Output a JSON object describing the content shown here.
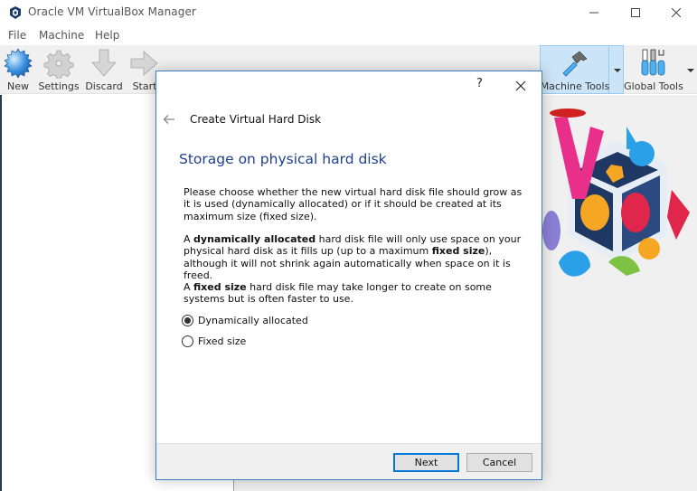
{
  "window": {
    "title": "Oracle VM VirtualBox Manager",
    "app_icon": "virtualbox-logo-icon",
    "controls": {
      "minimize": "minimize-icon",
      "maximize": "maximize-icon",
      "close": "close-icon"
    }
  },
  "menubar": {
    "items": [
      {
        "label": "File"
      },
      {
        "label": "Machine"
      },
      {
        "label": "Help"
      }
    ]
  },
  "toolbar": {
    "buttons": [
      {
        "label": "New",
        "icon": "new-starburst-icon"
      },
      {
        "label": "Settings",
        "icon": "gear-icon"
      },
      {
        "label": "Discard",
        "icon": "down-arrow-icon"
      },
      {
        "label": "Start",
        "icon": "right-arrow-icon"
      }
    ],
    "tools": [
      {
        "label": "Machine Tools",
        "icon": "hammer-icon",
        "active": true
      },
      {
        "label": "Global Tools",
        "icon": "tools-icon",
        "active": false
      }
    ]
  },
  "dialog": {
    "help_label": "?",
    "title": "Create Virtual Hard Disk",
    "heading": "Storage on physical hard disk",
    "paragraphs": {
      "p1": "Please choose whether the new virtual hard disk file should grow as it is used (dynamically allocated) or if it should be created at its maximum size (fixed size).",
      "p2_pre": "A ",
      "p2_bold1": "dynamically allocated",
      "p2_mid": " hard disk file will only use space on your physical hard disk as it fills up (up to a maximum ",
      "p2_bold2": "fixed size",
      "p2_post": "), although it will not shrink again automatically when space on it is freed.",
      "p3_pre": "A ",
      "p3_bold": "fixed size",
      "p3_post": " hard disk file may take longer to create on some systems but is often faster to use."
    },
    "options": [
      {
        "label": "Dynamically allocated",
        "selected": true
      },
      {
        "label": "Fixed size",
        "selected": false
      }
    ],
    "buttons": {
      "next": "Next",
      "cancel": "Cancel"
    }
  },
  "colors": {
    "accent": "#0078d7",
    "heading": "#1e3f8c",
    "active_tool_bg": "#cce4f7"
  }
}
